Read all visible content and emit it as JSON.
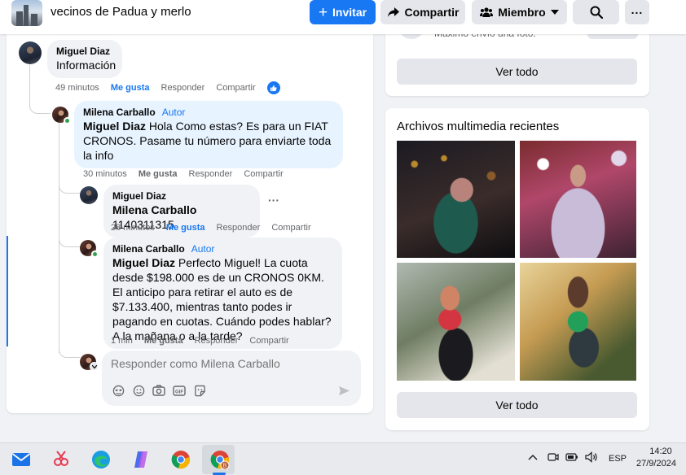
{
  "header": {
    "group_name": "vecinos de Padua y merlo",
    "buttons": {
      "invite": "Invitar",
      "share": "Compartir",
      "member": "Miembro"
    }
  },
  "comments": [
    {
      "author": "Miguel Diaz",
      "tag": "",
      "mention": "",
      "text": "Información",
      "time": "49 minutos",
      "like": "Me gusta",
      "reply": "Responder",
      "share": "Compartir",
      "reaction": "like"
    },
    {
      "author": "Milena Carballo",
      "tag": "Autor",
      "mention": "Miguel Diaz",
      "text": " Hola Como estas? Es para un FIAT CRONOS. Pasame tu número para enviarte toda la info",
      "time": "30 minutos",
      "like": "Me gusta",
      "reply": "Responder",
      "share": "Compartir"
    },
    {
      "author": "Miguel Diaz",
      "tag": "",
      "mention": "Milena Carballo",
      "text": " 1140311315",
      "time": "28 minutos",
      "like": "Me gusta",
      "reply": "Responder",
      "share": "Compartir"
    },
    {
      "author": "Milena Carballo",
      "tag": "Autor",
      "mention": "Miguel Diaz",
      "text": " Perfecto Miguel! La cuota desde $198.000 es de un CRONOS 0KM. El anticipo para retirar el auto es de $7.133.400, mientras tanto podes ir pagando en cuotas. Cuándo podes hablar? A la mañana o a la tarde?",
      "time": "1 min",
      "like": "Me gusta",
      "reply": "Responder",
      "share": "Compartir"
    }
  ],
  "reply_box": {
    "placeholder": "Responder como Milena Carballo"
  },
  "sidebar": {
    "partial_text": "Máximo envío una foto.",
    "see_all_1": "Ver todo",
    "media_title": "Archivos multimedia recientes",
    "see_all_2": "Ver todo"
  },
  "taskbar": {
    "language": "ESP",
    "time": "14:20",
    "date": "27/9/2024"
  },
  "colors": {
    "accent": "#1877f2",
    "online": "#31a24c",
    "author_bubble": "#e7f3ff"
  }
}
